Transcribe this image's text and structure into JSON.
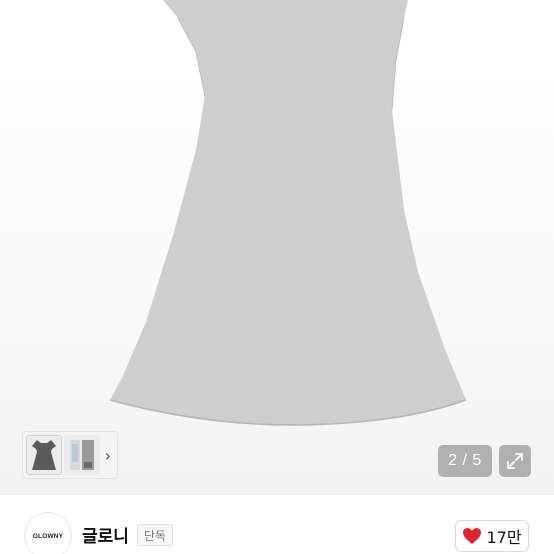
{
  "product_viewer": {
    "page_counter": "2 / 5",
    "thumbnail_count": 2
  },
  "shop": {
    "logo_text": "GLOWNY",
    "name": "글로니",
    "badge": "단독"
  },
  "like": {
    "count": "17만"
  },
  "colors": {
    "heart": "#e0222f",
    "dress": "#c9c9c9",
    "overlay": "#787878"
  },
  "icons": [
    "heart-icon",
    "expand-icon",
    "chevron-right-icon"
  ]
}
